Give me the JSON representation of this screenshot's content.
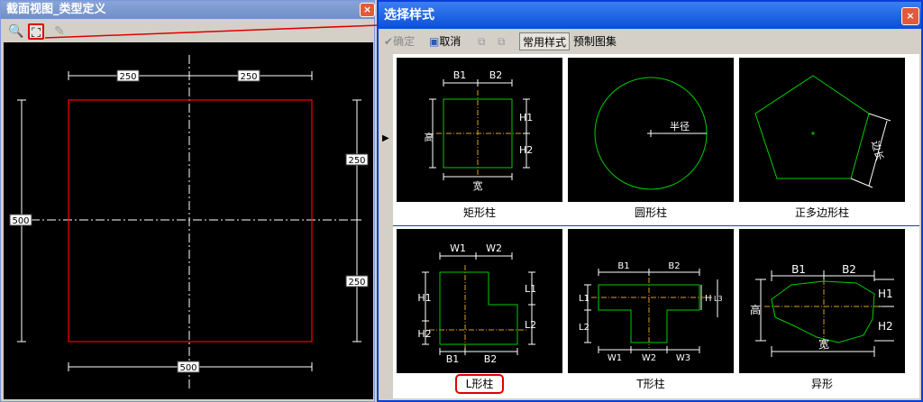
{
  "left_window": {
    "title": "截面视图_类型定义",
    "close_symbol": "×",
    "canvas": {
      "dim_top_left": "250",
      "dim_top_right": "250",
      "dim_right_top": "250",
      "dim_right_bottom": "250",
      "dim_left": "500",
      "dim_bottom": "500"
    }
  },
  "right_window": {
    "title": "选择样式",
    "close_symbol": "×",
    "toolbar": {
      "confirm": "确定",
      "cancel": "取消",
      "tab_common": "常用样式",
      "tab_preset": "预制图集"
    },
    "row_pointer": "▶",
    "styles": [
      {
        "label": "矩形柱",
        "marks": {
          "b1": "B1",
          "b2": "B2",
          "h1": "H1",
          "h2": "H2",
          "height": "高",
          "width": "宽"
        }
      },
      {
        "label": "圆形柱",
        "marks": {
          "radius": "半径"
        }
      },
      {
        "label": "正多边形柱",
        "marks": {
          "side": "边长"
        }
      },
      {
        "label": "L形柱",
        "marks": {
          "w1": "W1",
          "w2": "W2",
          "l1": "L1",
          "l2": "L2",
          "h1": "H1",
          "h2": "H2",
          "b1": "B1",
          "b2": "B2"
        }
      },
      {
        "label": "T形柱",
        "marks": {
          "b1": "B1",
          "b2": "B2",
          "l1": "L1",
          "l2": "L2",
          "h": "H",
          "l3": "L3",
          "w1": "W1",
          "w2": "W2",
          "w3": "W3"
        }
      },
      {
        "label": "异形",
        "marks": {
          "b1": "B1",
          "b2": "B2",
          "height": "高",
          "h1": "H1",
          "h2": "H2",
          "width": "宽"
        }
      }
    ]
  },
  "colors": {
    "left_title": "#7b9bd1",
    "right_title": "#0b4ed8",
    "section_outline": "#ff0000",
    "shape_outline": "#00cc00",
    "selected_highlight": "#e00000"
  }
}
